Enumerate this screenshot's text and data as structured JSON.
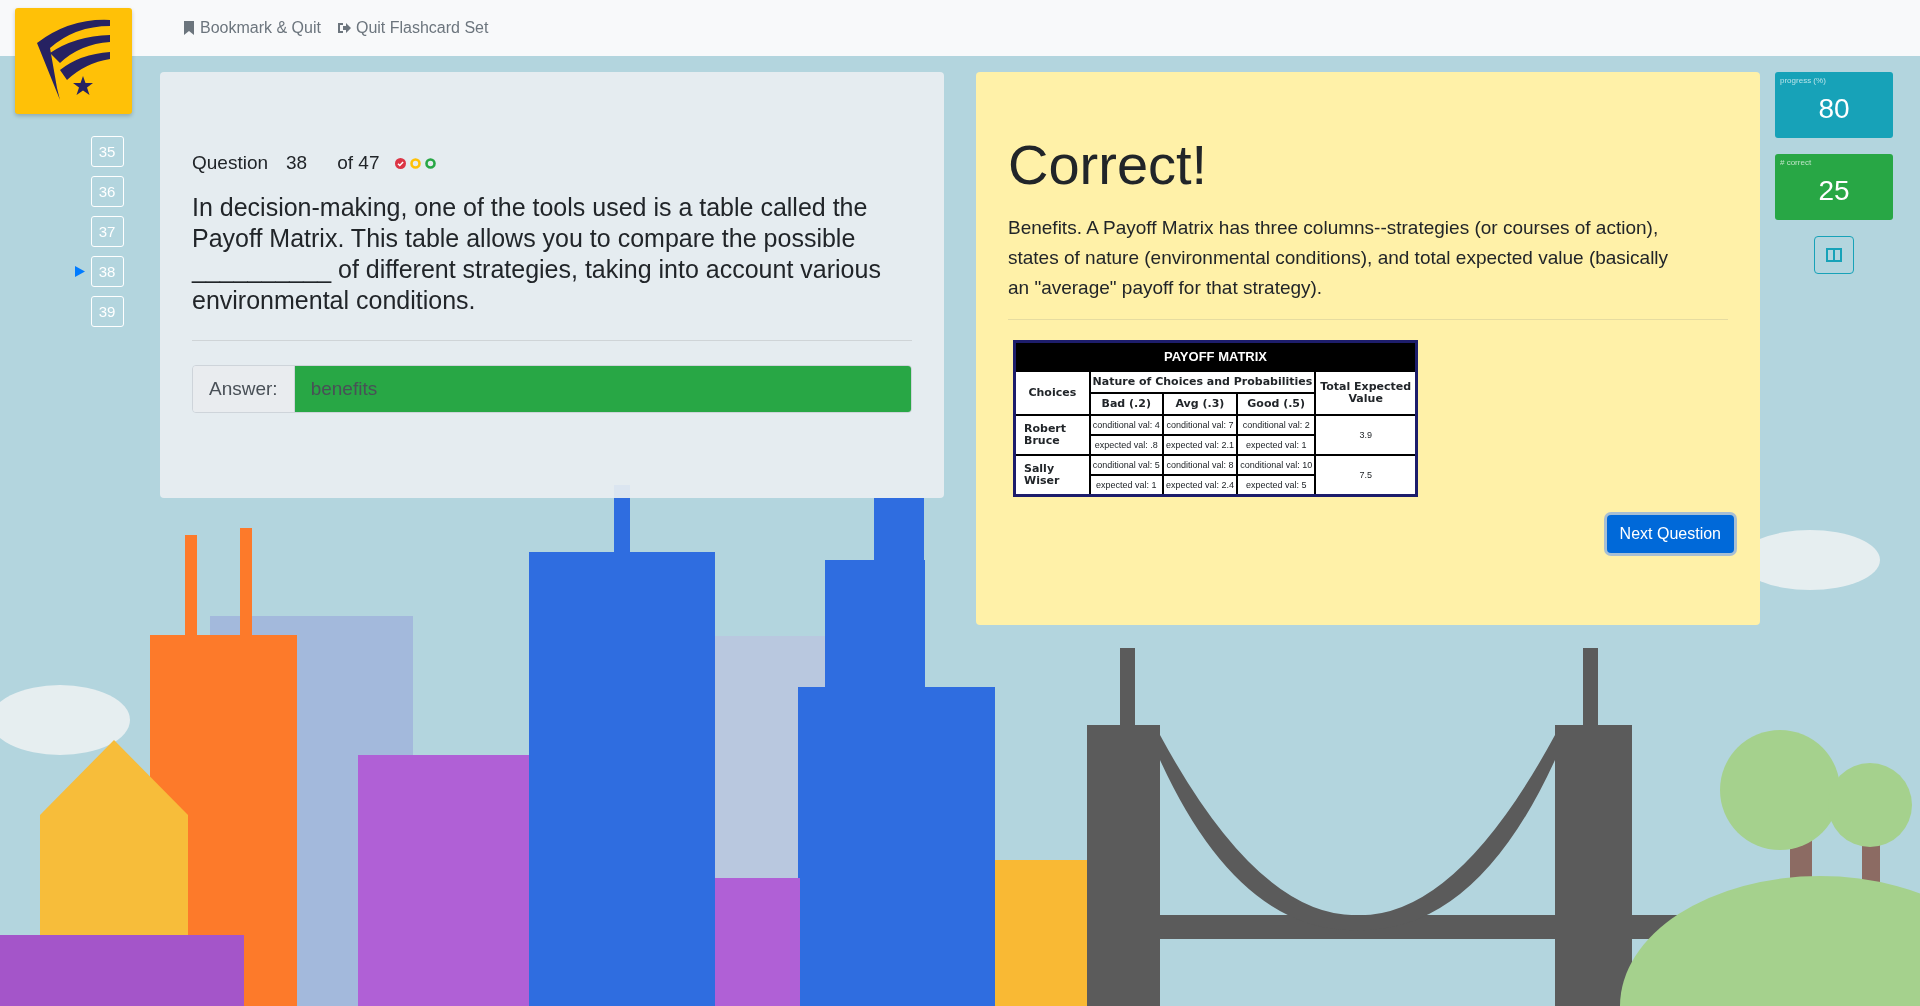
{
  "header": {
    "links": [
      {
        "label": "Bookmark & Quit",
        "kind": "bookmark"
      },
      {
        "label": "Quit Flashcard Set",
        "kind": "quit"
      }
    ]
  },
  "question_nav": [
    {
      "label": "35",
      "selected": false
    },
    {
      "label": "36",
      "selected": false
    },
    {
      "label": "37",
      "selected": false
    },
    {
      "label": "38",
      "selected": true
    },
    {
      "label": "39",
      "selected": false
    }
  ],
  "question": {
    "label": "Question",
    "number": "38",
    "total": "of 47",
    "attempts": [
      {
        "color": "#dc3545",
        "filled": true
      },
      {
        "color": "#ffc107",
        "filled": false
      },
      {
        "color": "#28a745",
        "filled": false
      }
    ],
    "text": "In decision-making, one of the tools used is a table called the Payoff Matrix. This table allows you to compare the possible __________ of different strategies, taking into account various environmental conditions.",
    "answer_label": "Answer:",
    "answer": "benefits",
    "correct": true
  },
  "feedback": {
    "title": "Correct!",
    "explanation": "Benefits. A Payoff Matrix has three columns--strategies (or courses of action), states of nature (environmental conditions), and total expected value (basically an \"average\" payoff for that strategy).",
    "matrix": {
      "title": "PAYOFF MATRIX",
      "choices_header": "Choices",
      "nature_header": "Nature of Choices and Probabilities",
      "total_header": "Total Expected Value",
      "probabilities": [
        "Bad (.2)",
        "Avg (.3)",
        "Good (.5)"
      ],
      "rows": [
        {
          "choice": "Robert Bruce",
          "conditional": [
            "conditional val: 4",
            "conditional val: 7",
            "conditional val: 2"
          ],
          "expected": [
            "expected val: .8",
            "expected val: 2.1",
            "expected val: 1"
          ],
          "total": "3.9"
        },
        {
          "choice": "Sally Wiser",
          "conditional": [
            "conditional val: 5",
            "conditional val: 8",
            "conditional val: 10"
          ],
          "expected": [
            "expected val: 1",
            "expected val: 2.4",
            "expected val: 5"
          ],
          "total": "7.5"
        }
      ]
    },
    "next_button": "Next Question"
  },
  "stats": [
    {
      "label": "progress (%)",
      "value": "80",
      "color": "#17a2b8"
    },
    {
      "label": "# correct",
      "value": "25",
      "color": "#28a745"
    }
  ]
}
